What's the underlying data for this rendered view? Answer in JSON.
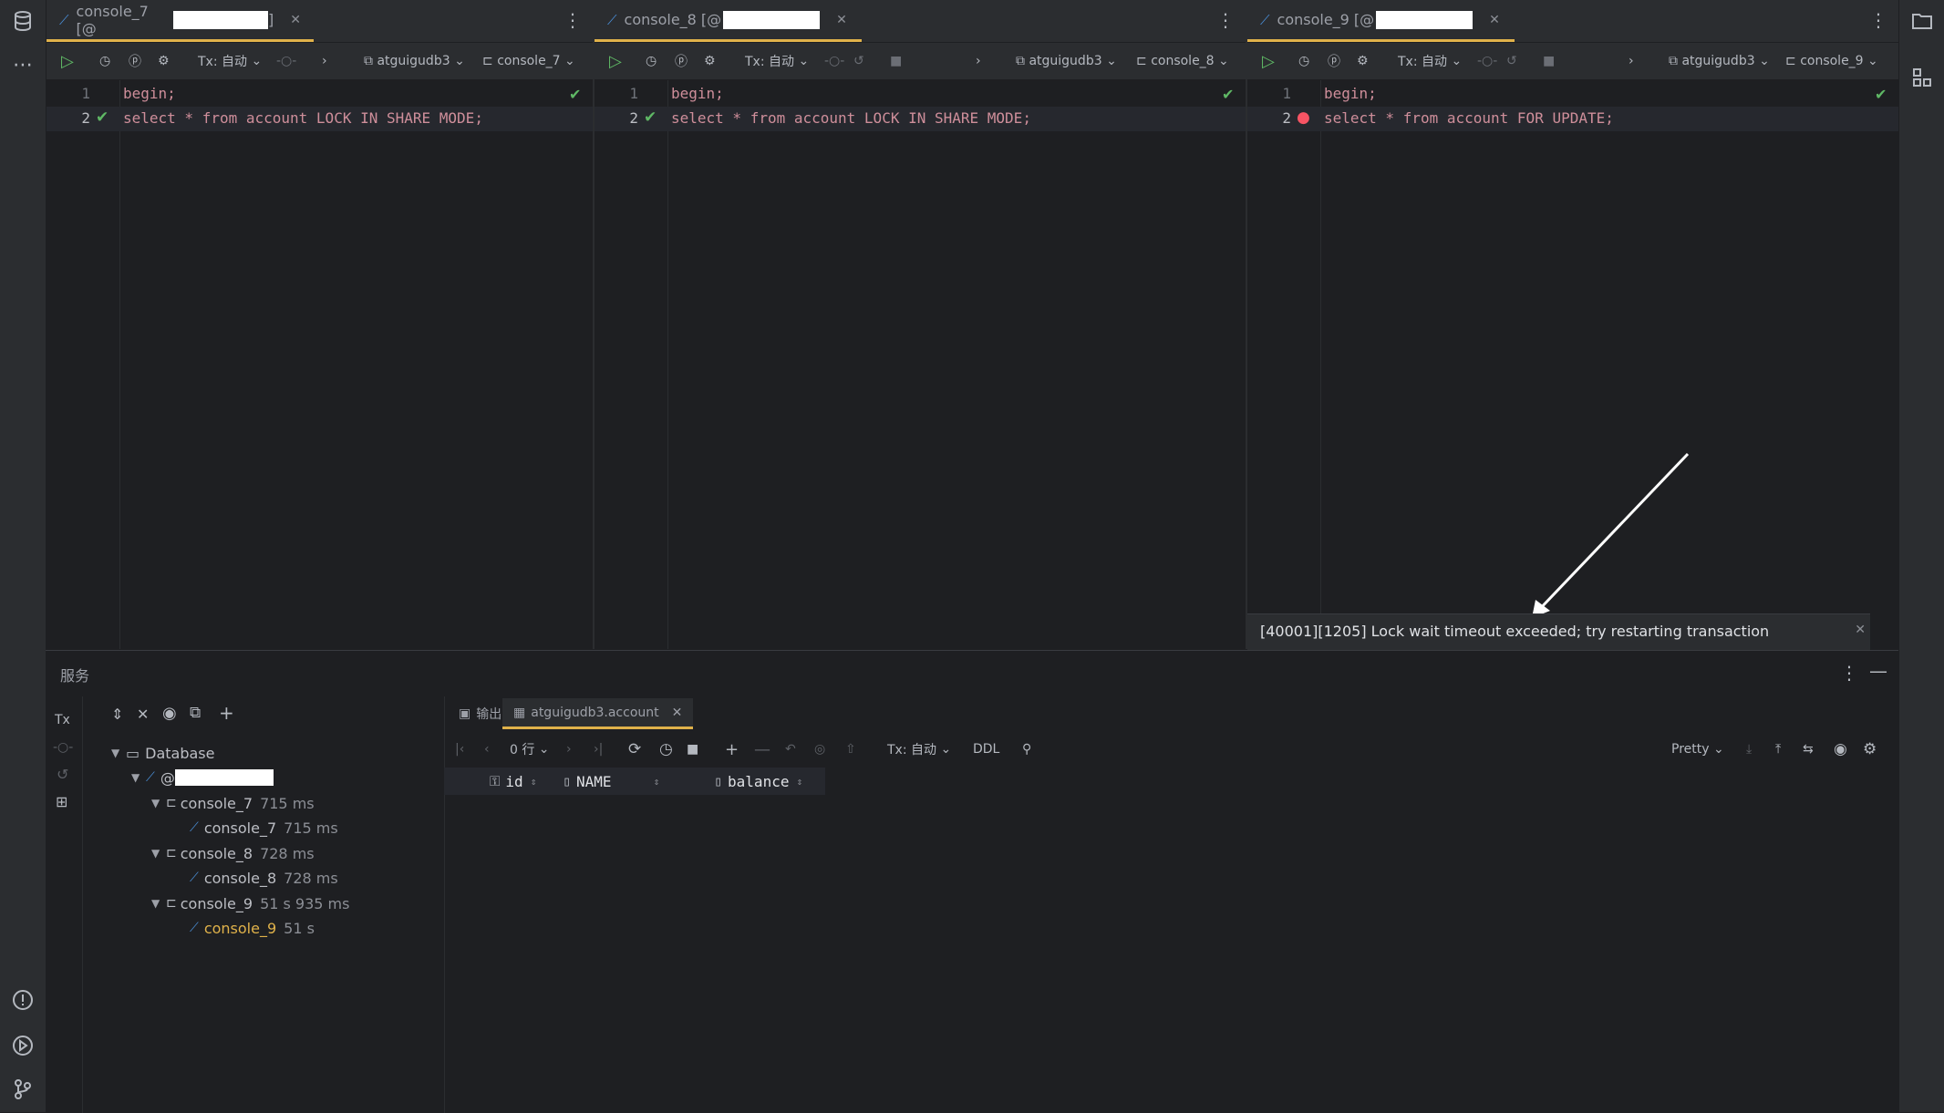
{
  "panes": [
    {
      "tab_title": "console_7 [@",
      "tx_label": "Tx: 自动",
      "database": "atguigudb3",
      "session": "console_7",
      "lines": [
        {
          "num": "1",
          "code": "begin;"
        },
        {
          "num": "2",
          "code": "select * from account LOCK IN SHARE MODE;"
        }
      ]
    },
    {
      "tab_title": "console_8 [@",
      "tx_label": "Tx: 自动",
      "database": "atguigudb3",
      "session": "console_8",
      "lines": [
        {
          "num": "1",
          "code": "begin;"
        },
        {
          "num": "2",
          "code": "select * from account LOCK IN SHARE MODE;"
        }
      ]
    },
    {
      "tab_title": "console_9 [@",
      "tx_label": "Tx: 自动",
      "database": "atguigudb3",
      "session": "console_9",
      "lines": [
        {
          "num": "1",
          "code": "begin;"
        },
        {
          "num": "2",
          "code": "select * from account FOR UPDATE;"
        }
      ]
    }
  ],
  "error_message": "[40001][1205] Lock wait timeout exceeded; try restarting transaction",
  "services": {
    "title": "服务",
    "tree": {
      "root": "Database",
      "connection_prefix": "@",
      "items": [
        {
          "label": "console_7",
          "time": "715 ms"
        },
        {
          "label": "console_7",
          "time": "715 ms"
        },
        {
          "label": "console_8",
          "time": "728 ms"
        },
        {
          "label": "console_8",
          "time": "728 ms"
        },
        {
          "label": "console_9",
          "time": "51 s 935 ms"
        },
        {
          "label": "console_9",
          "time": "51 s"
        }
      ]
    },
    "results": {
      "tabs": [
        "输出",
        "atguigudb3.account"
      ],
      "rows_label": "0 行",
      "tx_label": "Tx: 自动",
      "ddl_label": "DDL",
      "format_label": "Pretty",
      "columns": [
        "id",
        "NAME",
        "balance"
      ]
    }
  },
  "colors": {
    "accent_tab": "#e0b24a",
    "success": "#5fb865",
    "error": "#f75464",
    "keyword": "#ce6a72"
  }
}
